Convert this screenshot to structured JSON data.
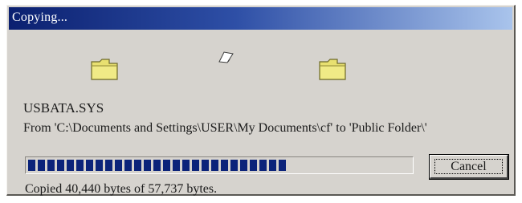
{
  "window": {
    "title": "Copying..."
  },
  "icons": {
    "source": "folder-icon",
    "moving": "flying-paper-icon",
    "destination": "folder-icon"
  },
  "file": {
    "name": "USBATA.SYS",
    "from_text": "From 'C:\\Documents and Settings\\USER\\My Documents\\cf' to 'Public Folder\\'"
  },
  "progress": {
    "fraction": 0.7
  },
  "buttons": {
    "cancel_label": "Cancel"
  },
  "status": {
    "text": "Copied 40,440 bytes of 57,737 bytes."
  },
  "colors": {
    "titlebar_start": "#0b2070",
    "titlebar_end": "#a9c4ec",
    "progress_block": "#0b237a",
    "dialog_face": "#d6d3ce"
  }
}
